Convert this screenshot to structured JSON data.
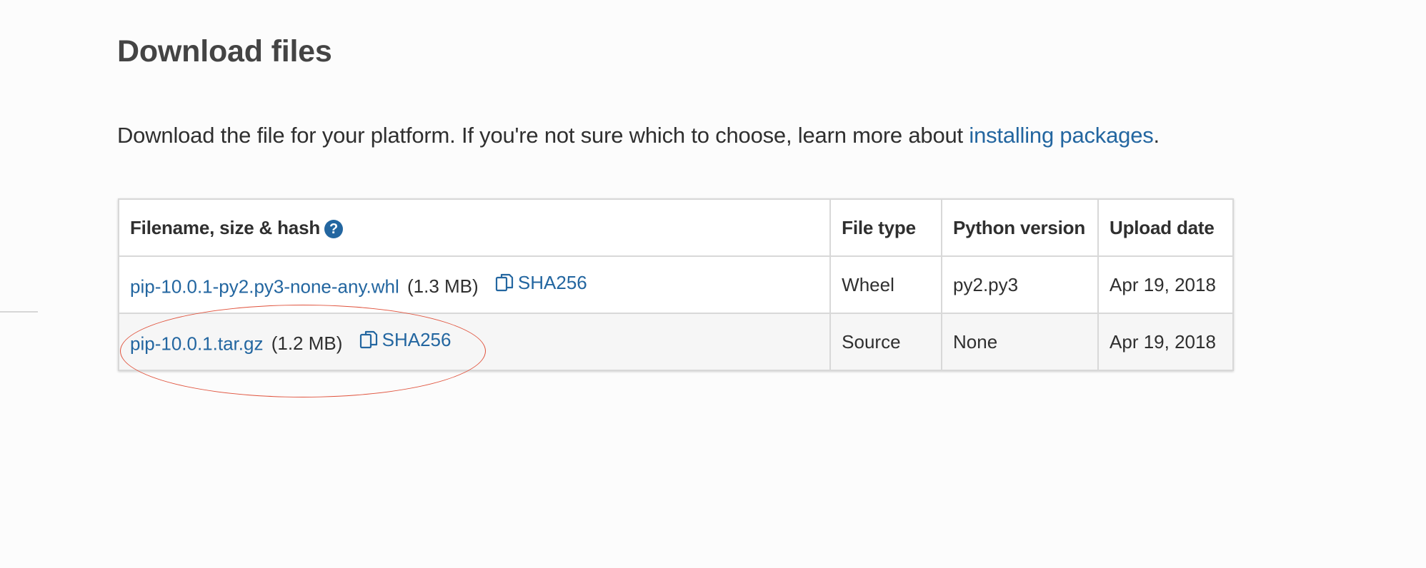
{
  "section": {
    "title": "Download files",
    "intro_text": "Download the file for your platform. If you're not sure which to choose, learn more about ",
    "intro_link": "installing packages",
    "intro_end": "."
  },
  "table": {
    "headers": {
      "filename": "Filename, size & hash",
      "file_type": "File type",
      "python_version": "Python version",
      "upload_date": "Upload date"
    },
    "help_icon": "question-circle-icon",
    "rows": [
      {
        "filename": "pip-10.0.1-py2.py3-none-any.whl",
        "size": "(1.3 MB)",
        "hash_label": "SHA256",
        "file_type": "Wheel",
        "python_version": "py2.py3",
        "upload_date": "Apr 19, 2018"
      },
      {
        "filename": "pip-10.0.1.tar.gz",
        "size": "(1.2 MB)",
        "hash_label": "SHA256",
        "file_type": "Source",
        "python_version": "None",
        "upload_date": "Apr 19, 2018"
      }
    ]
  },
  "colors": {
    "link": "#2366a0",
    "annotation": "#e0523c",
    "text": "#2f2f2f"
  }
}
